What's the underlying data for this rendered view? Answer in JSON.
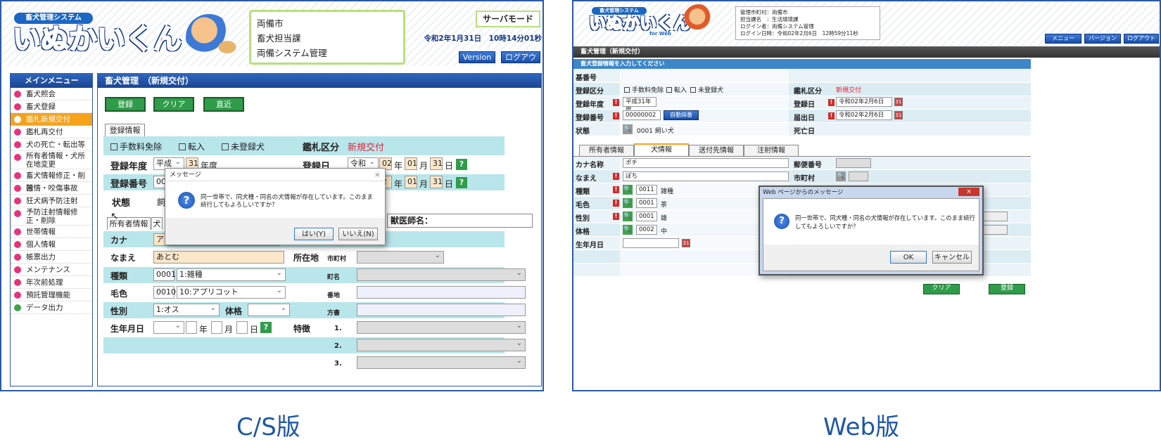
{
  "cs": {
    "logo_small": "畜犬管理システム",
    "logo_big": "いぬかいくん",
    "info": [
      "両備市",
      "畜犬担当課",
      "両備システム管理"
    ],
    "server_mode": "サーバモード",
    "datetime": "令和2年1月31日　10時14分01秒",
    "btn_version": "Version",
    "btn_logout": "ログアウト",
    "main_menu": "メインメニュー",
    "menu_items": [
      "畜犬照会",
      "畜犬登録",
      "鑑札新規交付",
      "鑑札再交付",
      "犬の死亡・転出等",
      "所有者情報・犬所在地変更",
      "畜犬情報修正・削除",
      "苦情・咬傷事故",
      "狂犬病予防注射",
      "予防注射情報修正・削除",
      "世帯情報",
      "個人情報",
      "帳票出力",
      "メンテナンス",
      "年次前処理",
      "預託管理機能",
      "データ出力"
    ],
    "section_title": "畜犬管理　（新規交付）",
    "btn_register": "登録",
    "btn_clear": "クリア",
    "btn_recent": "直近",
    "tab_reg_info": "登録情報",
    "chk_fee_exempt": "手数料免除",
    "chk_transfer_in": "転入",
    "chk_unregistered": "未登録犬",
    "label_tag_class": "鑑札区分",
    "value_tag_class": "新規交付",
    "label_reg_year": "登録年度",
    "reg_year_era": "平成",
    "reg_year_num": "31",
    "reg_year_suffix": "年度",
    "label_reg_date": "登録日",
    "reg_date_era": "令和",
    "reg_date_y": "02",
    "reg_date_m": "01",
    "reg_date_d": "31",
    "label_reg_no": "登録番号",
    "reg_no_prefix": "00",
    "reg_no2_y": "2",
    "reg_no2_m": "01",
    "reg_no2_d": "31",
    "label_status": "状態",
    "status_value": "飼",
    "unit_year": "年",
    "unit_month": "月",
    "unit_day": "日",
    "tab_owner": "所有者情報",
    "tab_dog_short": "犬",
    "label_vet": "獣医師名：",
    "label_kana": "カナ",
    "kana_value": "ア",
    "label_name": "なまえ",
    "name_value": "あとむ",
    "label_location": "所在地",
    "label_city": "市町村",
    "label_breed": "種類",
    "breed_code": "0001",
    "breed_value": "1:雑種",
    "label_town": "町名",
    "label_coat": "毛色",
    "coat_code": "0010",
    "coat_value": "10:アプリコット",
    "label_banchi": "番地",
    "label_sex": "性別",
    "sex_value": "1:オス",
    "label_size": "体格",
    "label_kata": "方書",
    "label_birth": "生年月日",
    "label_feature": "特徴",
    "feature_nums": [
      "1.",
      "2.",
      "3."
    ],
    "dialog_title": "メッセージ",
    "dialog_text": "同一世帯で、同犬種・同名の犬情報が存在しています。このまま続行してもよろしいですか？",
    "dialog_yes": "はい(Y)",
    "dialog_no": "いいえ(N)",
    "caption": "C/S版"
  },
  "web": {
    "logo_small": "畜犬管理システム",
    "logo_big": "いぬかいくん",
    "logo_sub": "for Web",
    "info_rows": [
      "管理市町村：両備市",
      "担当課名　：生活環境課",
      "ログイン者：両備システム管理",
      "ログイン日時：令和02年2月6日　12時59分11秒"
    ],
    "btn_menu": "メニュー",
    "btn_version": "バージョン",
    "btn_logout": "ログアウト",
    "section_title": "畜犬管理（新規交付）",
    "subhead": "畜犬登録情報を入力してください",
    "label_base_no": "基番号",
    "label_reg_class": "登録区分",
    "chk_fee_exempt": "手数料免除",
    "chk_transfer_in": "転入",
    "chk_unregistered": "未登録犬",
    "label_tag_class": "鑑札区分",
    "value_tag_class": "新規交付",
    "label_reg_year": "登録年度",
    "reg_year_value": "平成31年度",
    "label_reg_date": "登録日",
    "reg_date_value": "令和02年2月6日",
    "label_reg_no": "登録番号",
    "reg_no_value": "00000002",
    "btn_auto_no": "自動採番",
    "label_submit_date": "届出日",
    "submit_date_value": "令和02年2月6日",
    "label_status": "状態",
    "status_value": "0001 飼い犬",
    "label_death": "死亡日",
    "tabs": [
      "所有者情報",
      "犬情報",
      "送付先情報",
      "注射情報"
    ],
    "label_kana": "カナ名称",
    "kana_value": "ポチ",
    "label_postal": "郵便番号",
    "label_name": "なまえ",
    "name_value": "ぽち",
    "label_city": "市町村",
    "label_breed": "種類",
    "breed_code": "0011",
    "breed_value": "雑種",
    "label_coat": "毛色",
    "coat_code": "0001",
    "coat_value": "茶",
    "label_sex": "性別",
    "sex_code": "0001",
    "sex_value": "雄",
    "label_size": "体格",
    "size_code": "0002",
    "size_value": "中",
    "label_birth": "生年月日",
    "btn_clear": "クリア",
    "btn_register": "登録",
    "dialog_title": "Web ページからのメッセージ",
    "dialog_text1": "同一世帯で、同犬種・同名の犬情報が存在しています。このまま続行",
    "dialog_text2": "してもよろしいですか？",
    "dialog_ok": "OK",
    "dialog_cancel": "キャンセル",
    "caption": "Web版"
  },
  "colors": {
    "frame": "#2a5aa8",
    "header_blue": "#1a4fa8",
    "row_cyan": "#b9e6ea",
    "accent_pink": "#e8337c",
    "active_orange": "#f6a21a",
    "green_button": "#2f9c4a",
    "red_text": "#e0223a",
    "caption": "#1e57a6"
  }
}
